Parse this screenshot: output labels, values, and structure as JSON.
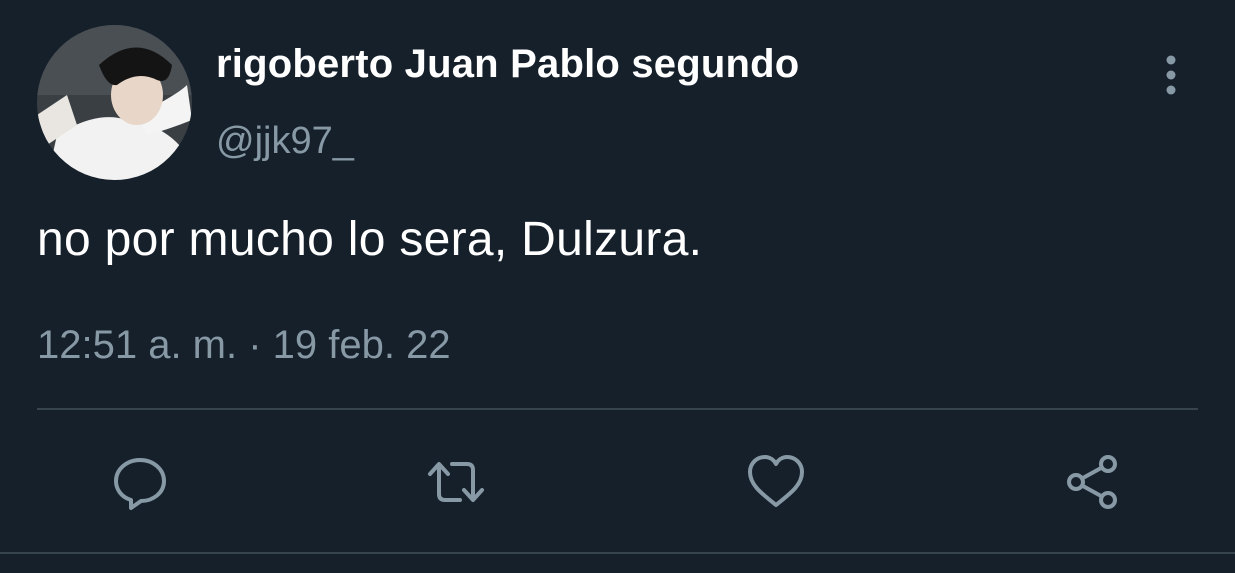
{
  "tweet": {
    "display_name": "rigoberto Juan Pablo segundo",
    "handle": "@jjk97_",
    "text": "no por mucho lo sera, Dulzura.",
    "timestamp": "12:51 a. m. · 19 feb. 22"
  },
  "actions": [
    {
      "name": "reply",
      "icon": "speech-bubble-icon"
    },
    {
      "name": "retweet",
      "icon": "retweet-arrows-icon"
    },
    {
      "name": "like",
      "icon": "heart-icon"
    },
    {
      "name": "share",
      "icon": "share-icon"
    }
  ],
  "colors": {
    "background": "#15202b",
    "primary_text": "#ffffff",
    "secondary_text": "#8899a6",
    "divider": "#38444d"
  }
}
